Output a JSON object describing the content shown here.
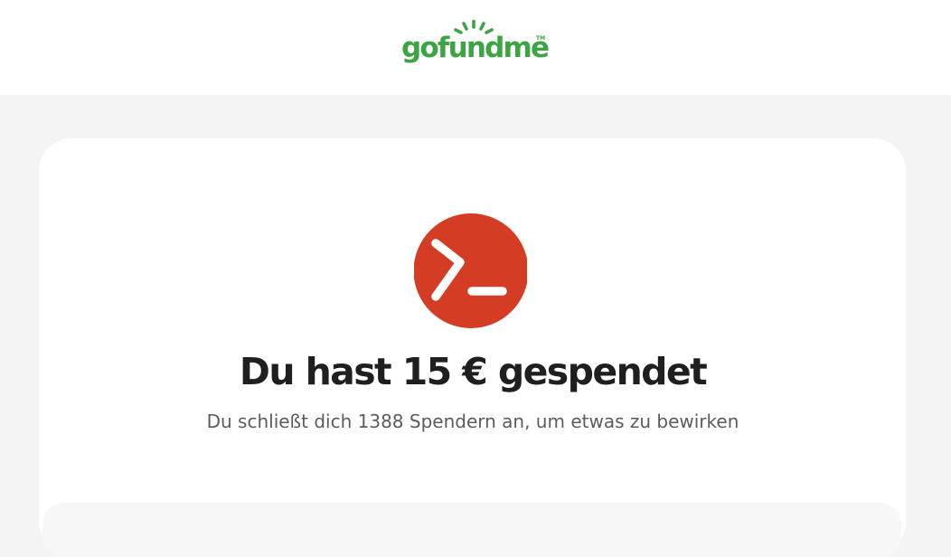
{
  "header": {
    "logo_text": "gofundme",
    "logo_tm": "TM",
    "logo_icon": "sun-rays-icon"
  },
  "colors": {
    "brand_green": "#3ca445",
    "avatar_red": "#d43c24",
    "page_background": "#f4f4f4",
    "card_background": "#ffffff"
  },
  "confirmation": {
    "avatar_icon": "terminal-prompt-icon",
    "title": "Du hast 15 € gespendet",
    "subtitle": "Du schließt dich 1388 Spendern an, um etwas zu bewirken"
  }
}
